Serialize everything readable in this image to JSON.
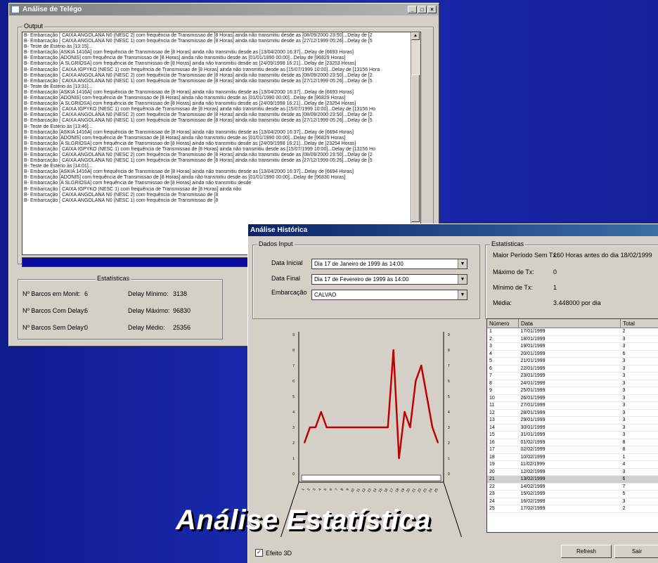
{
  "win1": {
    "title": "Análise de Telégo",
    "output_label": "Output",
    "lines": [
      "B- Embarcação [ CAIXA ANGOLANA N0 (NESC 2) com frequência de Transmissao de [8 Horas] ainda não transmitiu desde as [08/09/2000 23:50]...Delay de [2",
      "B- Embarcação [ CAIXA ANGOLANA N0 (NESC 1) com frequência de Transmissao de [8 Horas] ainda não transmitiu desde as [27/12/1999 05:26]...Delay de [5",
      "B- Teste de Estério às [13:15]...",
      "B- Embarcação [ASKIA 1416A] com frequência de Transmissao de [8 Horas] ainda não transmitiu desde as [13/04/2000 16:37]...Delay de [6693 Horas]",
      "B- Embarcação [ADONIS] com frequência de Transmissao de [8 Horas] ainda não transmitiu desde as [01/01/1990 00:00]...Delay de [96829 Horas]",
      "B- Embarcação [A SLGRIOSA] com frequência de Transmissao de [8 Horas] ainda não transmitiu desde as [24/09/1998 16:21]...Delay de [23253 Horas]",
      "B- Embarcação [ CAIXA IGPYKO (NESC 1) com frequência de Transmissao de [8 Horas] ainda não transmitiu desde as [15/07/1999 10:00]...Delay de [13156 Hora",
      "B- Embarcação [ CAIXA ANGOLANA N0 (NESC 2) com frequência de Transmissao de [8 Horas] ainda não transmitiu desde as [08/09/2000 23:50]...Delay de [2",
      "B- Embarcação [ CAIXA ANGOLANA N0 (NESC 1) com frequência de Transmissao de [8 Horas] ainda não transmitiu desde as [27/12/1999 05:26]...Delay de [5",
      "B- Teste de Estério às [13:31]...",
      "B- Embarcação [ASKIA 1416A] com frequência de Transmissao de [8 Horas] ainda não transmitiu desde as [13/04/2000 16:37]...Delay de [6693 Horas]",
      "B- Embarcação [ADONIS] com frequência de Transmissao de [8 Horas] ainda não transmitiu desde as [01/01/1990 00:00]...Delay de [96829 Horas]",
      "B- Embarcação [A SLGRIOSA] com frequência de Transmissao de [8 Horas] ainda não transmitiu desde as [24/09/1998 16:21]...Delay de [23254 Horas]",
      "B- Embarcação [ CAIXA IGPYKO (NESC 1) com frequência de Transmissao de [8 Horas] ainda não transmitiu desde as [15/07/1999 10:00]...Delay de [13156 Ho",
      "B- Embarcação [ CAIXA ANGOLANA N0 (NESC 2) com frequência de Transmissao de [8 Horas] ainda não transmitiu desde as [08/09/2000 23:50]...Delay de [2",
      "B- Embarcação [ CAIXA ANGOLANA N0 (NESC 1) com frequência de Transmissao de [8 Horas] ainda não transmitiu desde as [27/12/1999 05:26]...Delay de [5",
      "B- Teste de Estério às [13:46]...",
      "B- Embarcação [ASKIA 1416A] com frequência de Transmissao de [8 Horas] ainda não transmitiu desde as [13/04/2000 16:37]...Delay de [6694 Horas]",
      "B- Embarcação [ADONIS] com frequência de Transmissao de [8 Horas] ainda não transmitiu desde as [01/01/1990 00:00]...Delay de [96829 Horas]",
      "B- Embarcação [A SLGRIOSA] com frequência de Transmissao de [8 Horas] ainda não transmitiu desde as [24/09/1998 16:21]...Delay de [23254 Horas]",
      "B- Embarcação [ CAIXA IGPYKO (NESC 1) com frequência de Transmissao de [8 Horas] ainda não transmitiu desde as [15/07/1999 10:00]...Delay de [13156 Ho",
      "B- Embarcação [ CAIXA ANGOLANA N0 (NESC 2) com frequência de Transmissao de [8 Horas] ainda não transmitiu desde as [08/09/2000 23:50]...Delay de [2",
      "B- Embarcação [ CAIXA ANGOLANA N0 (NESC 1) com frequência de Transmissao de [8 Horas] ainda não transmitiu desde as [27/12/1999 05:26]...Delay de [5",
      "B- Teste de Estério às [14:01]...",
      "B- Embarcação [ASKIA 1416A] com frequência de Transmissao de [8 Horas] ainda não transmitiu desde as [13/04/2000 16:37]...Delay de [6694 Horas]",
      "B- Embarcação [ADONIS] com frequência de Transmissao de [8 Horas] ainda não transmitiu desde as [01/01/1990 00:00]...Delay de [96830 Horas]",
      "B- Embarcação [A SLGRIOSA] com frequência de Transmissao de [8 Horas] ainda não transmitiu desde",
      "B- Embarcação [ CAIXA IGPYKO (NESC 1) com frequência de Transmissao de [8 Horas] ainda não",
      "B- Embarcação [ CAIXA ANGOLANA N0 (NESC 2) com frequência de Transmissao de [8",
      "B- Embarcação [ CAIXA ANGOLANA N0 (NESC 1) com frequência de Transmissao de [8"
    ],
    "stats": {
      "label": "Estatísticas",
      "rows": [
        {
          "l1": "Nº Barcos em Monit:",
          "v1": "6",
          "l2": "Delay Mínimo:",
          "v2": "3138"
        },
        {
          "l1": "Nº Barcos Com Delay:",
          "v1": "6",
          "l2": "Delay Máximo:",
          "v2": "96830"
        },
        {
          "l1": "Nº Barcos Sem Delay:",
          "v1": "0",
          "l2": "Delay Médio:",
          "v2": "25356"
        }
      ]
    }
  },
  "win2": {
    "title": "Análise Histórica",
    "input": {
      "label": "Dados Input",
      "data_inicial_label": "Data Inicial",
      "data_inicial": "Dia 17 de  Janeiro  de 1999 às 14:00",
      "data_final_label": "Data Final",
      "data_final": "Dia 17 de  Fevereiro  de 1999 às 14:00",
      "embarcacao_label": "Embarcação",
      "embarcacao": "CALVAO"
    },
    "stats": {
      "label": "Estatísticas",
      "maior_label": "Maior Período Sem Tx:",
      "maior_value": "160 Horas antes do dia 18/02/1999",
      "max_label": "Máximo de Tx:",
      "max_value": "0",
      "min_label": "Mínimo de Tx:",
      "min_value": "1",
      "media_label": "Média:",
      "media_value": "3.448000 por dia"
    },
    "table": {
      "headers": [
        "Número",
        "Data",
        "Total"
      ],
      "rows": [
        [
          "1",
          "17/01/1999",
          "2"
        ],
        [
          "2",
          "18/01/1999",
          "3"
        ],
        [
          "3",
          "19/01/1999",
          "3"
        ],
        [
          "4",
          "20/01/1999",
          "6"
        ],
        [
          "5",
          "21/01/1999",
          "3"
        ],
        [
          "6",
          "22/01/1999",
          "3"
        ],
        [
          "7",
          "23/01/1999",
          "3"
        ],
        [
          "8",
          "24/01/1999",
          "3"
        ],
        [
          "9",
          "25/01/1999",
          "3"
        ],
        [
          "10",
          "26/01/1999",
          "3"
        ],
        [
          "11",
          "27/01/1999",
          "3"
        ],
        [
          "12",
          "28/01/1999",
          "3"
        ],
        [
          "13",
          "29/01/1999",
          "3"
        ],
        [
          "14",
          "30/01/1999",
          "3"
        ],
        [
          "15",
          "31/01/1999",
          "3"
        ],
        [
          "16",
          "01/02/1999",
          "8"
        ],
        [
          "17",
          "02/02/1999",
          "8"
        ],
        [
          "18",
          "10/02/1999",
          "1"
        ],
        [
          "19",
          "11/02/1999",
          "4"
        ],
        [
          "20",
          "12/02/1999",
          "3"
        ],
        [
          "21",
          "13/02/1999",
          "6"
        ],
        [
          "22",
          "14/02/1999",
          "7"
        ],
        [
          "23",
          "15/02/1999",
          "5"
        ],
        [
          "24",
          "16/02/1999",
          "3"
        ],
        [
          "25",
          "17/02/1999",
          "2"
        ]
      ],
      "selected_row": 20
    },
    "checkbox_label": "Efeito 3D",
    "refresh_label": "Refresh",
    "sair_label": "Sair"
  },
  "caption": "Análise Estatística",
  "chart_data": {
    "type": "line",
    "x": [
      1,
      2,
      3,
      4,
      5,
      6,
      7,
      8,
      9,
      10,
      11,
      12,
      13,
      14,
      15,
      16,
      17,
      18,
      19,
      20,
      21,
      22,
      23,
      24,
      25
    ],
    "series": [
      {
        "values": [
          2,
          3,
          3,
          4,
          3,
          3,
          3,
          3,
          3,
          3,
          3,
          3,
          3,
          3,
          3,
          3,
          8,
          1,
          4,
          3,
          6,
          7,
          5,
          3,
          2
        ]
      }
    ],
    "y_ticks": [
      "9",
      "8",
      "7",
      "6",
      "5",
      "4",
      "3",
      "2",
      "1",
      "0"
    ],
    "ylim": [
      0,
      9
    ],
    "x_ticks": [
      "1",
      "2",
      "3",
      "4",
      "5",
      "6",
      "7",
      "8",
      "9",
      "10",
      "11",
      "12",
      "13",
      "14",
      "15",
      "16",
      "17",
      "18",
      "19",
      "20",
      "21",
      "22",
      "23",
      "24",
      "25"
    ],
    "line_color": "#c00000",
    "grid": true
  }
}
